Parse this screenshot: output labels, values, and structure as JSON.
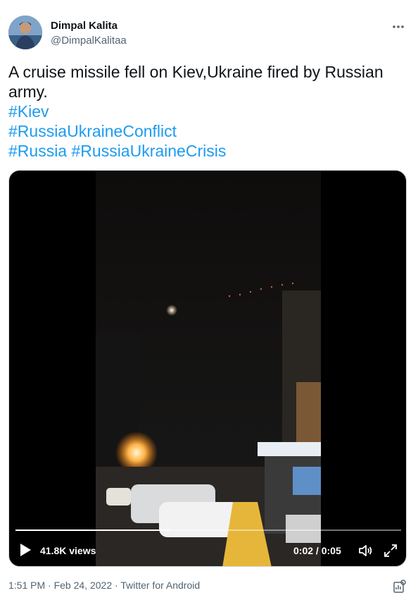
{
  "author": {
    "name": "Dimpal Kalita",
    "handle": "@DimpalKalitaa"
  },
  "tweet": {
    "text": "A cruise missile fell on Kiev,Ukraine fired by Russian army.",
    "hashtags": [
      "#Kiev",
      "#RussiaUkraineConflict",
      "#Russia",
      "#RussiaUkraineCrisis"
    ]
  },
  "video": {
    "views": "41.8K views",
    "current_time": "0:02",
    "separator": " / ",
    "duration": "0:05",
    "progress": 0.4
  },
  "footer": {
    "time": "1:51 PM",
    "date": "Feb 24, 2022",
    "source": "Twitter for Android",
    "sep": " · "
  },
  "colors": {
    "link": "#1d9bf0",
    "secondary_text": "#536471",
    "primary_text": "#0f1419"
  },
  "icons": {
    "more": "more-horizontal-icon",
    "play": "play-icon",
    "volume": "volume-icon",
    "fullscreen": "fullscreen-icon",
    "analytics": "analytics-icon"
  }
}
